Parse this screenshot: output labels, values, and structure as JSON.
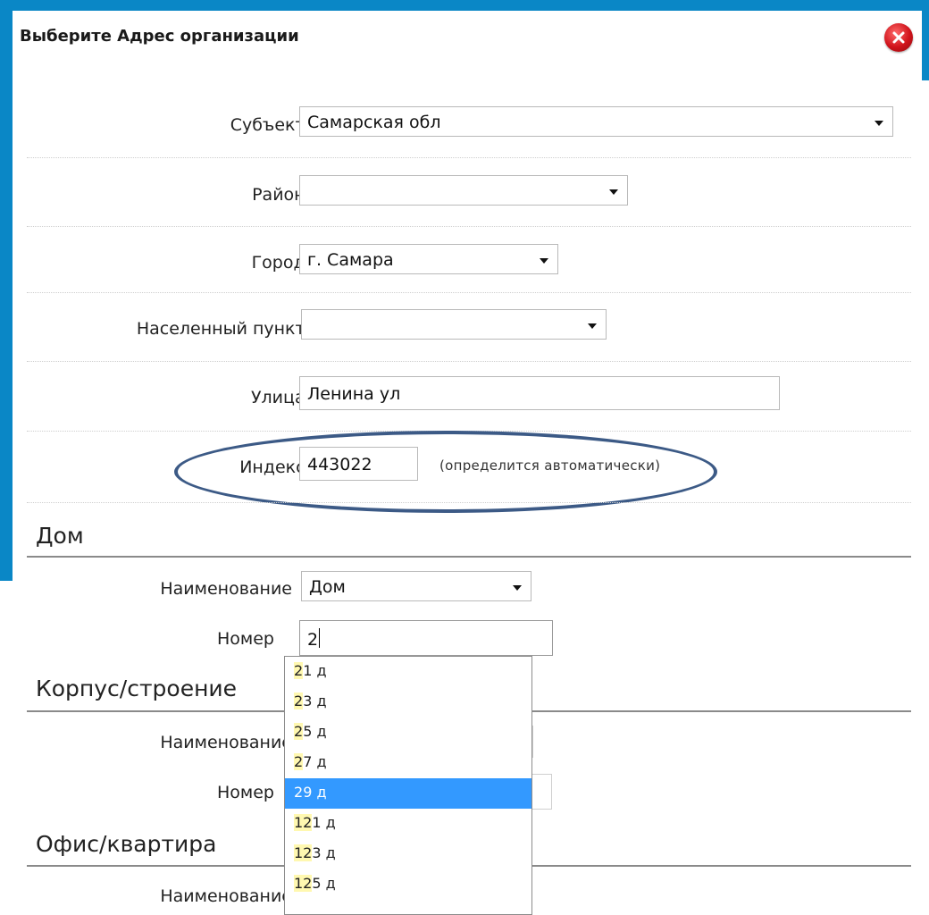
{
  "dialog": {
    "title": "Выберите Адрес организации",
    "close_icon": "close-circle-icon"
  },
  "address": {
    "subject": {
      "label": "Субъект:",
      "value": "Самарская обл"
    },
    "district": {
      "label": "Район:",
      "value": ""
    },
    "city": {
      "label": "Город:",
      "value": "г. Самара"
    },
    "settlement": {
      "label": "Населенный пункт:",
      "value": ""
    },
    "street": {
      "label": "Улица:",
      "value": "Ленина ул"
    },
    "postcode": {
      "label": "Индекс:",
      "value": "443022",
      "hint": "(определится автоматически)"
    }
  },
  "house": {
    "title": "Дом",
    "name_label": "Наименование",
    "name_value": "Дом",
    "number_label": "Номер",
    "number_value": "2"
  },
  "building": {
    "title": "Корпус/строение",
    "name_label": "Наименование",
    "number_label": "Номер"
  },
  "office": {
    "title": "Офис/квартира",
    "name_label": "Наименование"
  },
  "autocomplete": {
    "items": [
      {
        "match": "2",
        "rest": "1 д"
      },
      {
        "match": "2",
        "rest": "3 д"
      },
      {
        "match": "2",
        "rest": "5 д"
      },
      {
        "match": "2",
        "rest": "7 д"
      },
      {
        "match": "2",
        "rest": "9 д"
      },
      {
        "match": "12",
        "rest": "1 д"
      },
      {
        "match": "12",
        "rest": "3 д"
      },
      {
        "match": "12",
        "rest": "5 д"
      }
    ],
    "selected_index": 4
  },
  "colors": {
    "frame": "#0a87c6",
    "highlight": "#3399ff",
    "match": "#fff8b0",
    "annotation": "#3c5a86"
  }
}
